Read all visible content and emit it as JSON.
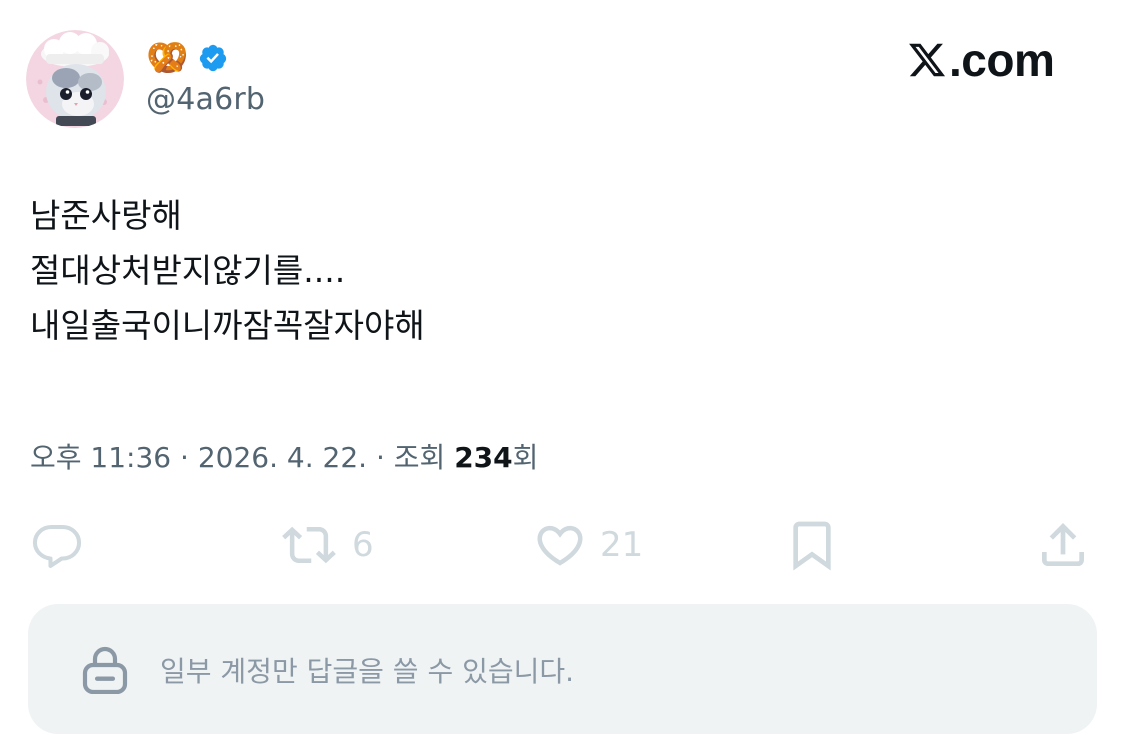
{
  "author": {
    "display_name_icon": "pretzel-emoji",
    "display_name_emoji": "🥨",
    "verified_icon": "verified-badge-icon",
    "handle": "@4a6rb",
    "avatar_icon": "cat-in-chef-hat-avatar"
  },
  "brand": {
    "logo_icon": "x-logo-icon",
    "domain_text": ".com"
  },
  "tweet": {
    "lines": [
      "남준사랑해",
      "절대상처받지않기를....",
      "내일출국이니까잠꼭잘자야해"
    ]
  },
  "meta": {
    "time": "오후 11:36",
    "separator": "·",
    "date": "2026. 4. 22.",
    "views_label": "조회",
    "views_count": "234",
    "views_suffix": "회"
  },
  "actions": {
    "reply_icon": "speech-bubble-icon",
    "retweet_icon": "retweet-icon",
    "retweet_count": "6",
    "like_icon": "heart-icon",
    "like_count": "21",
    "bookmark_icon": "bookmark-icon",
    "share_icon": "share-icon"
  },
  "reply_restriction": {
    "icon": "lock-icon",
    "text": "일부 계정만 답글을 쓸 수 있습니다."
  },
  "colors": {
    "text_primary": "#0f1419",
    "text_secondary": "#536471",
    "action_icon": "#cfd9de",
    "verified": "#1d9bf0",
    "reply_box_bg": "#eff3f4"
  }
}
